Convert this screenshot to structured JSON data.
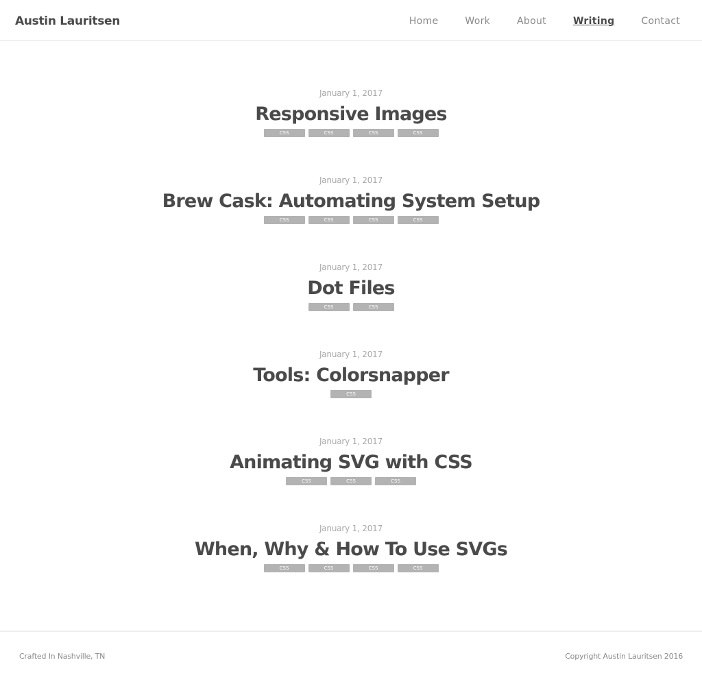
{
  "site": {
    "brand": "Austin Lauritsen"
  },
  "nav": {
    "items": [
      {
        "label": "Home",
        "active": false
      },
      {
        "label": "Work",
        "active": false
      },
      {
        "label": "About",
        "active": false
      },
      {
        "label": "Writing",
        "active": true
      },
      {
        "label": "Contact",
        "active": false
      }
    ]
  },
  "posts": [
    {
      "date": "January 1, 2017",
      "title": "Responsive Images",
      "tags": [
        "CSS",
        "CSS",
        "CSS",
        "CSS"
      ]
    },
    {
      "date": "January 1, 2017",
      "title": "Brew Cask: Automating System Setup",
      "tags": [
        "CSS",
        "CSS",
        "CSS",
        "CSS"
      ]
    },
    {
      "date": "January 1, 2017",
      "title": "Dot Files",
      "tags": [
        "CSS",
        "CSS"
      ]
    },
    {
      "date": "January 1, 2017",
      "title": "Tools: Colorsnapper",
      "tags": [
        "CSS"
      ]
    },
    {
      "date": "January 1, 2017",
      "title": "Animating SVG with CSS",
      "tags": [
        "CSS",
        "CSS",
        "CSS"
      ]
    },
    {
      "date": "January 1, 2017",
      "title": "When, Why & How To Use SVGs",
      "tags": [
        "CSS",
        "CSS",
        "CSS",
        "CSS"
      ]
    }
  ],
  "footer": {
    "left": "Crafted In Nashville, TN",
    "right": "Copyright Austin Lauritsen 2016"
  },
  "colors": {
    "text": "#4a4a4a",
    "muted": "#8a8a8a",
    "tag_bg": "#b3b3b3"
  }
}
